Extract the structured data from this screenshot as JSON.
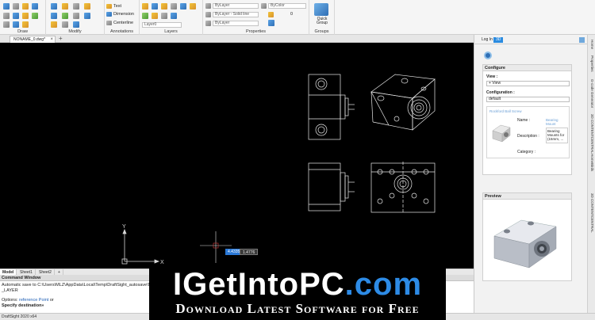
{
  "ribbon": {
    "groups": [
      "Draw",
      "Modify",
      "Annotations",
      "Layers",
      "Properties",
      "Groups"
    ],
    "annotations": {
      "text": "Text",
      "dimension": "Dimension",
      "centerline": "Centerline"
    },
    "layers": {
      "layer": "Layer0"
    },
    "properties": {
      "color_bylayer": "ByLayer",
      "linetype": "ByLayer - Solid line",
      "lineweight": "ByLayer",
      "color_bycolor": "ByColor",
      "value": "0"
    },
    "quick_group": "Quick Group"
  },
  "document_tab": {
    "label": "NONAME_0.dwg*",
    "close": "×",
    "add": "+"
  },
  "canvas": {
    "coord_x": "4.4335",
    "coord_y": "1.4776"
  },
  "model_tabs": [
    "Model",
    "Sheet1",
    "Sheet2",
    "+"
  ],
  "command": {
    "title": "Command Window",
    "line1": "Automatic save to C:\\Users\\MLZ\\AppData\\Local\\Temp\\DraftSight_autosave\\NONAM",
    "line2": "_LAYER",
    "options_prefix": "Options:",
    "option_link": "reference Point",
    "options_suffix": "or",
    "prompt": "Specify destination»"
  },
  "status_bar": {
    "text": "DraftSight 2020 x64"
  },
  "panel": {
    "tabs": [
      "Log In",
      "3D"
    ],
    "configure": {
      "title": "Configure",
      "view_label": "View :",
      "view_value": "+ View",
      "config_label": "Configuration :",
      "config_value": "default",
      "part_title": "Rockford Ball Screw",
      "name_label": "Name :",
      "name_value": "Bearing Mount",
      "description_label": "Description :",
      "description_value": "Bearing Mounts for (15mm, ...",
      "category_label": "Category :"
    },
    "preview": {
      "title": "Preview"
    }
  },
  "side_tabs": [
    "Home",
    "Properties",
    "G-code Generator",
    "3D CONTENTCENTRAL",
    "HomeBirds",
    "3D CONTENTCENTRAL"
  ],
  "watermark": {
    "brand_pre": "IGetIntoPC",
    "brand_suffix": ".com",
    "tagline": "Download Latest Software for Free"
  }
}
